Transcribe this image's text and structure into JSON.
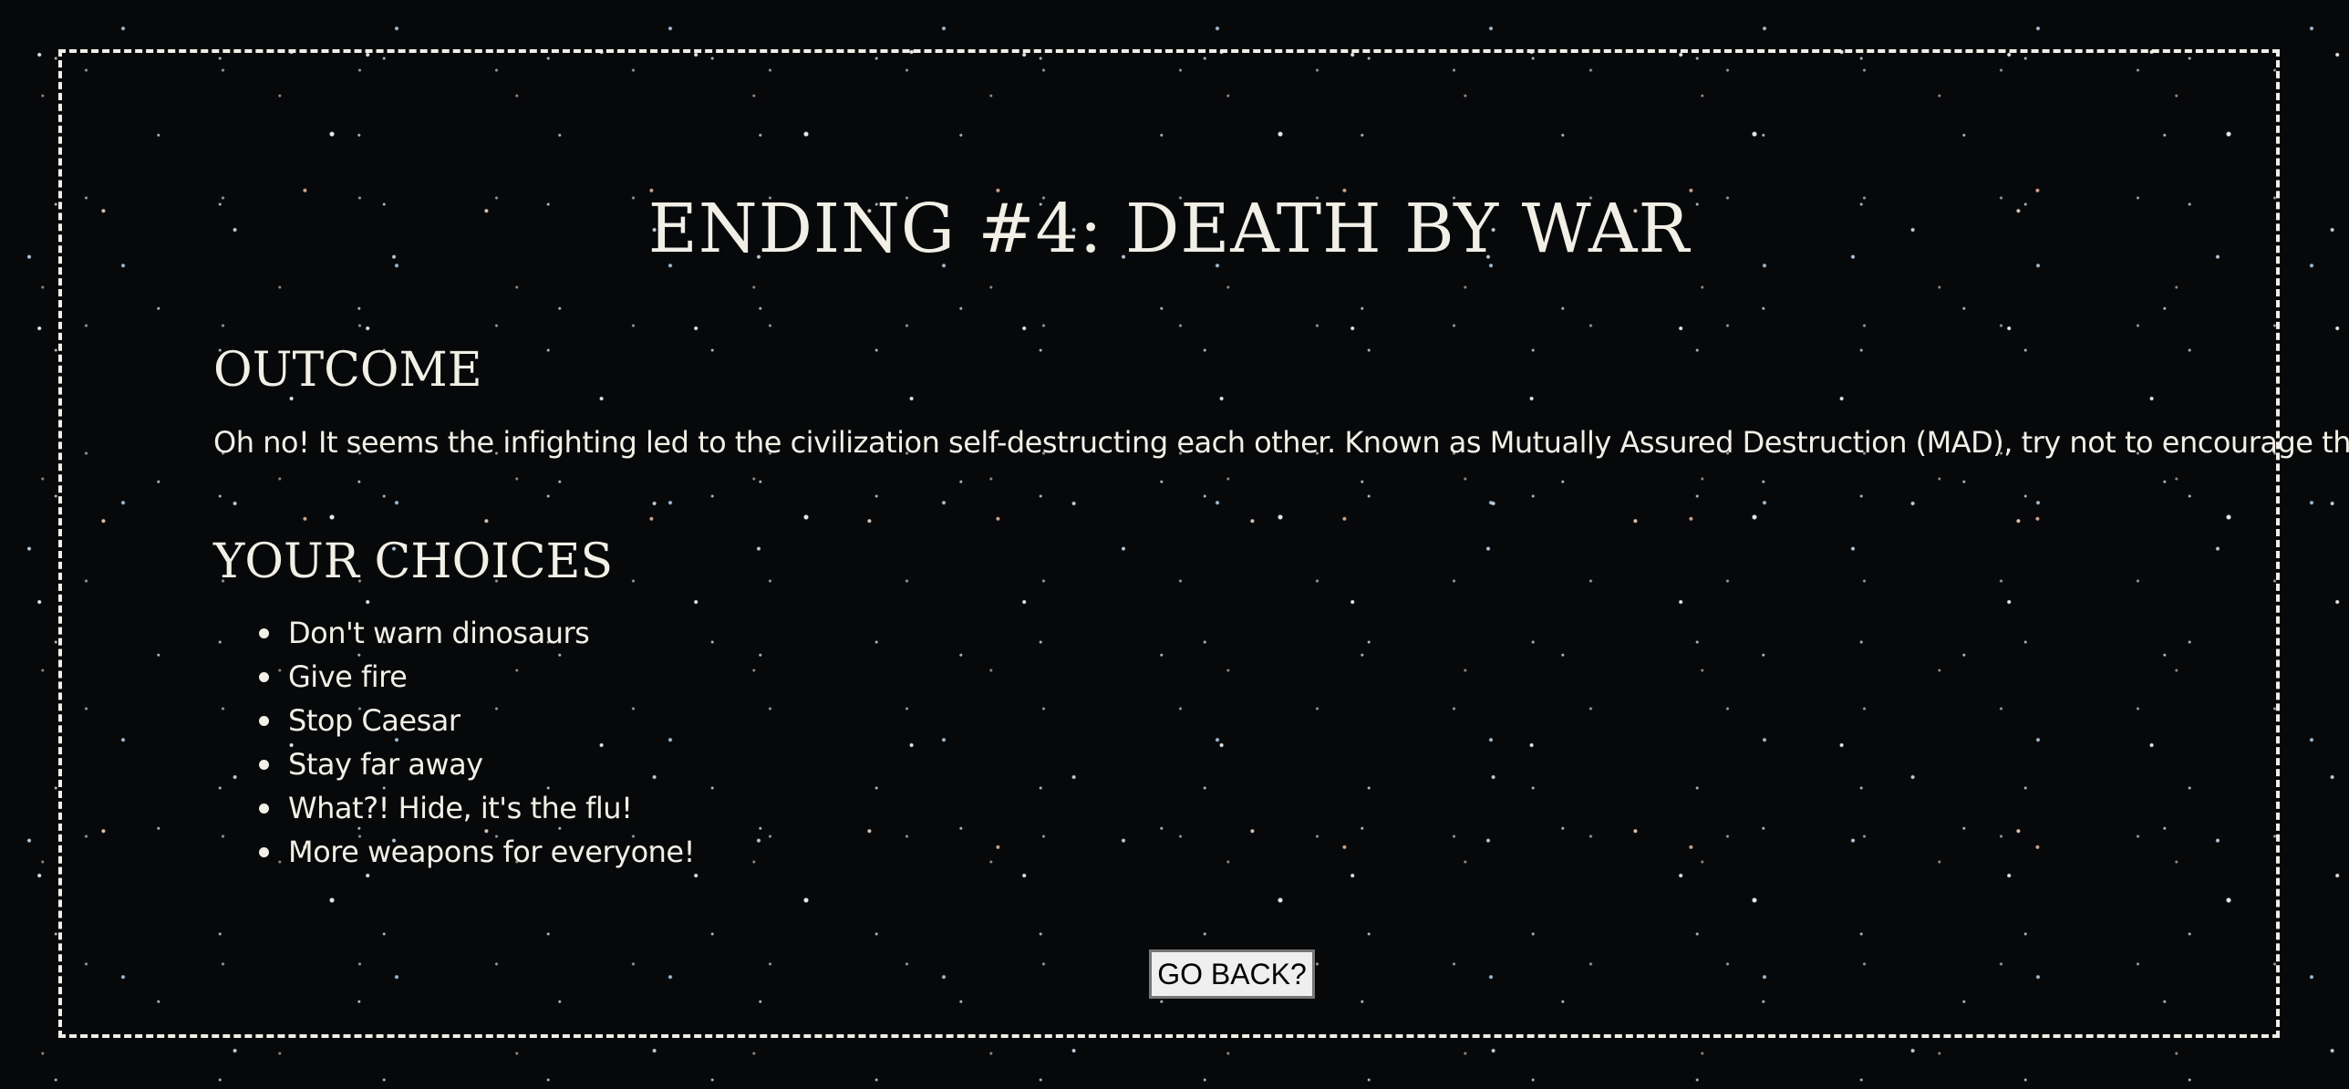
{
  "ending": {
    "title": "ENDING #4: DEATH BY WAR"
  },
  "outcome": {
    "heading": "OUTCOME",
    "text": "Oh no! It seems the infighting led to the civilization self-destructing each other. Known as Mutually Assured Destruction (MAD), try not to encourage them..."
  },
  "choices": {
    "heading": "YOUR CHOICES",
    "items": [
      "Don't warn dinosaurs",
      "Give fire",
      "Stop Caesar",
      "Stay far away",
      "What?! Hide, it's the flu!",
      "More weapons for everyone!"
    ]
  },
  "actions": {
    "go_back_label": "GO BACK?"
  },
  "colors": {
    "text": "#f2efe6",
    "frame_border": "#f1efe8",
    "background": "#07080a"
  }
}
